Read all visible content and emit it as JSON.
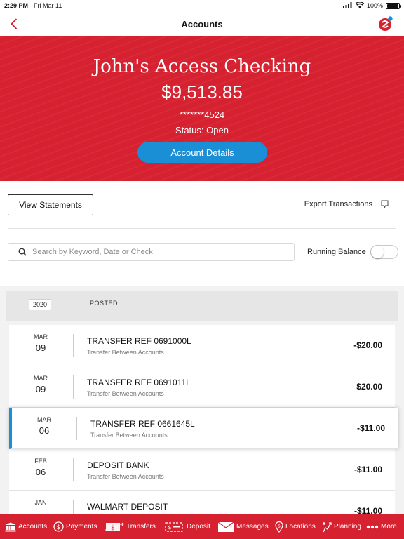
{
  "status_bar": {
    "time": "2:29 PM",
    "date": "Fri Mar 11",
    "battery": "100%"
  },
  "nav": {
    "title": "Accounts"
  },
  "account": {
    "name": "John's Access Checking",
    "balance": "$9,513.85",
    "masked_number": "*******4524",
    "status": "Status: Open",
    "details_button": "Account Details"
  },
  "actions": {
    "view_statements": "View Statements",
    "export": "Export Transactions",
    "search_placeholder": "Search by Keyword, Date or Check",
    "running_balance": "Running Balance",
    "running_balance_on": false
  },
  "list_header": {
    "year": "2020",
    "posted": "POSTED"
  },
  "transactions": [
    {
      "mon": "MAR",
      "day": "09",
      "desc": "TRANSFER REF 0691000L",
      "sub": "Transfer Between Accounts",
      "amount": "-$20.00"
    },
    {
      "mon": "MAR",
      "day": "09",
      "desc": "TRANSFER REF 0691011L",
      "sub": "Transfer Between Accounts",
      "amount": "$20.00"
    },
    {
      "mon": "MAR",
      "day": "06",
      "desc": "TRANSFER REF 0661645L",
      "sub": "Transfer Between Accounts",
      "amount": "-$11.00"
    },
    {
      "mon": "FEB",
      "day": "06",
      "desc": "DEPOSIT BANK",
      "sub": "Transfer Between Accounts",
      "amount": "-$11.00"
    },
    {
      "mon": "JAN",
      "day": "",
      "desc": "WALMART DEPOSIT",
      "sub": "",
      "amount": "-$11.00"
    }
  ],
  "tabs": [
    {
      "label": "Accounts",
      "icon": "bank-icon"
    },
    {
      "label": "Payments",
      "icon": "dollar-circle-icon"
    },
    {
      "label": "Transfers",
      "icon": "transfer-icon"
    },
    {
      "label": "Deposit",
      "icon": "check-deposit-icon"
    },
    {
      "label": "Messages",
      "icon": "envelope-icon"
    },
    {
      "label": "Locations",
      "icon": "location-pin-icon"
    },
    {
      "label": "Planning",
      "icon": "planning-icon"
    },
    {
      "label": "More",
      "icon": "more-dots-icon"
    }
  ],
  "colors": {
    "brand_red": "#d62130",
    "accent_blue": "#1a8fd6"
  }
}
